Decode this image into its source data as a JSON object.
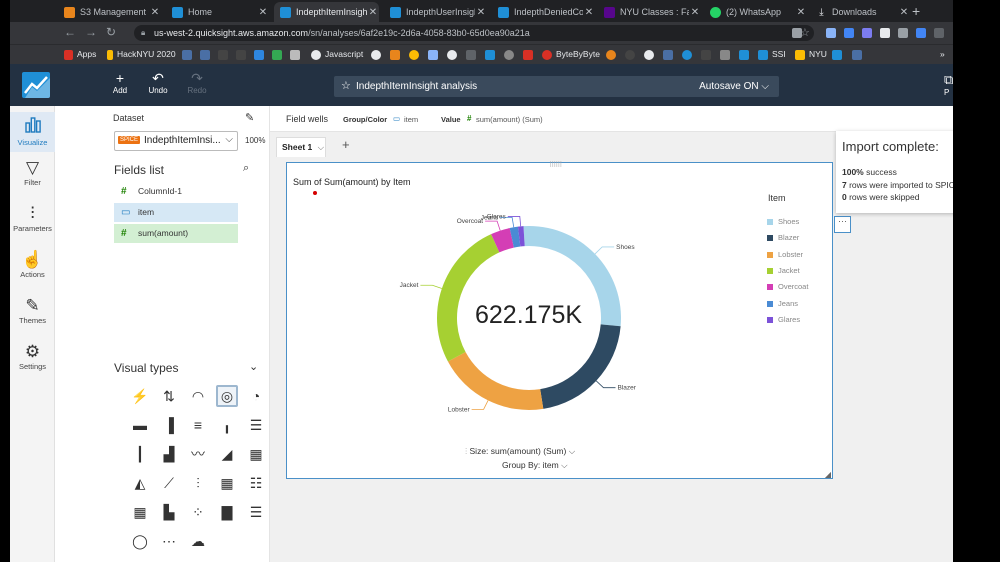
{
  "browser": {
    "tabs": [
      {
        "title": "S3 Management C",
        "color": "#e8851c",
        "active": false
      },
      {
        "title": "Home",
        "color": "#1f8fd6",
        "active": false
      },
      {
        "title": "IndepthItemInsigh",
        "color": "#1f8fd6",
        "active": true
      },
      {
        "title": "IndepthUserInsigh",
        "color": "#1f8fd6",
        "active": false
      },
      {
        "title": "IndepthDeniedCo",
        "color": "#1f8fd6",
        "active": false
      },
      {
        "title": "NYU Classes : Fall",
        "color": "#57068c",
        "active": false
      },
      {
        "title": "(2) WhatsApp",
        "color": "#25d366",
        "active": false
      },
      {
        "title": "Downloads",
        "color": "#333333",
        "active": false
      }
    ],
    "new_tab": "+",
    "url_host": "us-west-2.quicksight.aws.amazon.com",
    "url_path": "/sn/analyses/6af2e19c-2d6a-4058-83b0-65d0ea90a21a",
    "bookmarks": {
      "apps": "Apps",
      "hacknyu": "HackNYU 2020",
      "javascript": "Javascript",
      "bytebybyte": "ByteByByte",
      "ssi": "SSI",
      "nyu": "NYU",
      "more": "»"
    }
  },
  "quicksight": {
    "toolbar": {
      "add": "Add",
      "undo": "Undo",
      "redo": "Redo",
      "publish": "P"
    },
    "analysis_title": "IndepthItemInsight analysis",
    "autosave": "Autosave ON",
    "nav": [
      {
        "label": "Visualize",
        "icon": "visualize-icon",
        "glyph": "▯▯▯",
        "active": true
      },
      {
        "label": "Filter",
        "icon": "filter-icon",
        "glyph": "▽",
        "active": false
      },
      {
        "label": "Parameters",
        "icon": "parameters-icon",
        "glyph": "⫶",
        "active": false
      },
      {
        "label": "Actions",
        "icon": "actions-icon",
        "glyph": "☝",
        "active": false
      },
      {
        "label": "Themes",
        "icon": "themes-icon",
        "glyph": "✎",
        "active": false
      },
      {
        "label": "Settings",
        "icon": "settings-icon",
        "glyph": "⚙",
        "active": false
      }
    ],
    "dataset": {
      "label": "Dataset",
      "badge": "SPICE",
      "name": "IndepthItemInsi...",
      "percent": "100%"
    },
    "fields_list": {
      "label": "Fields list",
      "fields": [
        {
          "name": "ColumnId-1",
          "type": "#",
          "state": "none"
        },
        {
          "name": "item",
          "type": "▭",
          "state": "dim"
        },
        {
          "name": "sum(amount)",
          "type": "#",
          "state": "meas"
        }
      ]
    },
    "visual_types_label": "Visual types",
    "field_wells": {
      "label": "Field wells",
      "group_label": "Group/Color",
      "group_value": "item",
      "value_label": "Value",
      "value_value": "sum(amount) (Sum)"
    },
    "sheet": {
      "name": "Sheet 1",
      "add": "+"
    },
    "visual": {
      "title": "Sum of Sum(amount) by Item",
      "center_value": "622.175K",
      "size_control": "Size: sum(amount) (Sum)",
      "group_control": "Group By: item",
      "legend_title": "Item"
    },
    "toast": {
      "title": "Import complete:",
      "line1_bold": "100%",
      "line1": " success",
      "line2_bold": "7",
      "line2": " rows were imported to SPICE",
      "line3_bold": "0",
      "line3": " rows were skipped"
    }
  },
  "chart_data": {
    "type": "pie",
    "title": "Sum of Sum(amount) by Item",
    "center_label": "622.175K",
    "legend_title": "Item",
    "categories": [
      "Shoes",
      "Blazer",
      "Lobster",
      "Jacket",
      "Overcoat",
      "Jeans",
      "Glares"
    ],
    "values": [
      170,
      131,
      122,
      162,
      21,
      9,
      6
    ],
    "colors": [
      "#a7d5ea",
      "#2e4a62",
      "#eea243",
      "#a6d032",
      "#d43eb5",
      "#4a8bd4",
      "#7c52d8"
    ]
  }
}
